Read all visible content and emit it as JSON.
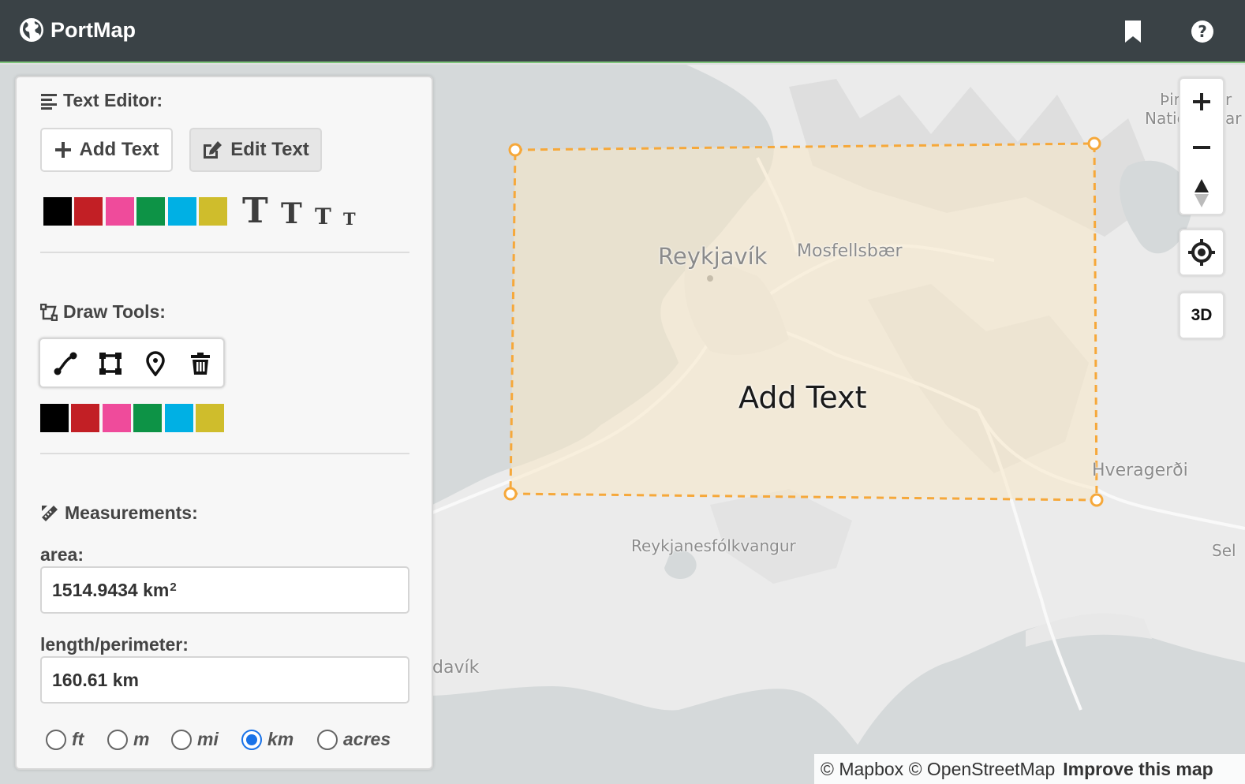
{
  "app": {
    "title": "PortMap"
  },
  "topbar": {
    "icons": [
      "globe-icon",
      "bookmark-icon",
      "help-icon"
    ]
  },
  "panel": {
    "text_editor": {
      "title": "Text Editor:",
      "add_text_label": "Add Text",
      "edit_text_label": "Edit Text",
      "colors": [
        "#000000",
        "#c21f25",
        "#ef4b9b",
        "#0d9346",
        "#00b0e4",
        "#cfbd2c"
      ],
      "text_sizes_glyph": "T"
    },
    "draw_tools": {
      "title": "Draw Tools:",
      "tools": [
        "line-tool",
        "polygon-tool",
        "marker-tool",
        "trash-tool"
      ],
      "colors": [
        "#000000",
        "#c21f25",
        "#ef4b9b",
        "#0d9346",
        "#00b0e4",
        "#cfbd2c"
      ]
    },
    "measurements": {
      "title": "Measurements:",
      "area_label": "area:",
      "area_value": "1514.9434 km",
      "area_unit_exponent": "2",
      "length_label": "length/perimeter:",
      "length_value": "160.61 km",
      "units": [
        {
          "label": "ft",
          "checked": false
        },
        {
          "label": "m",
          "checked": false
        },
        {
          "label": "mi",
          "checked": false
        },
        {
          "label": "km",
          "checked": true
        },
        {
          "label": "acres",
          "checked": false
        }
      ]
    }
  },
  "map": {
    "annotation_text": "Add Text",
    "places": {
      "reykjavik": "Reykjavík",
      "mosfellsbaer": "Mosfellsbær",
      "hveragerdi": "Hveragerði",
      "reykjanesfolkvangur": "Reykjanesfólkvangur",
      "davik": "davík",
      "thingvellir_1": "Þir",
      "thingvellir_1b": "r",
      "thingvellir_2": "Natio",
      "thingvellir_2b": "ar",
      "sel": "Sel"
    },
    "controls": {
      "three_d_label": "3D"
    }
  },
  "attribution": {
    "mapbox": "© Mapbox",
    "osm": "© OpenStreetMap",
    "improve": "Improve this map"
  }
}
